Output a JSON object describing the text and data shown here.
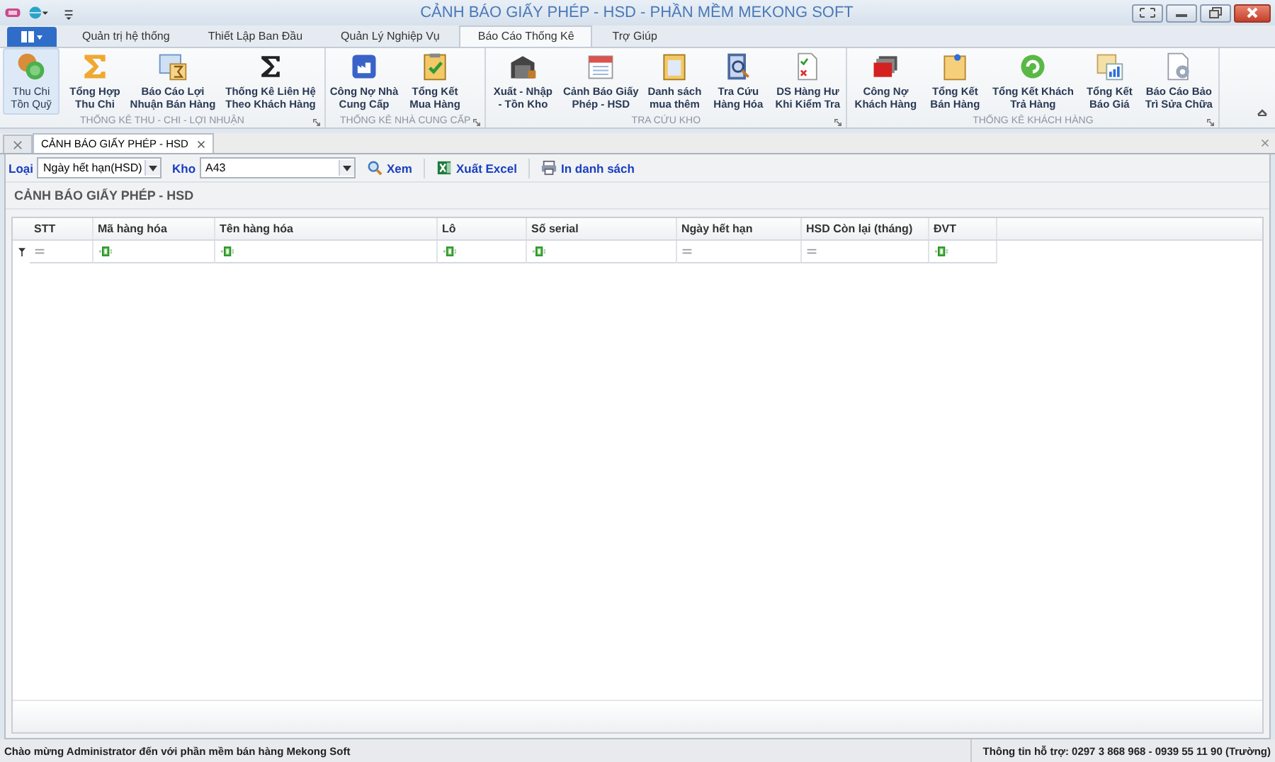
{
  "window": {
    "title": "CẢNH BÁO GIẤY PHÉP - HSD - PHẦN MỀM MEKONG SOFT"
  },
  "ribbon": {
    "tabs": [
      {
        "label": "Quản trị hệ thống",
        "selected": false
      },
      {
        "label": "Thiết Lập Ban Đầu",
        "selected": false
      },
      {
        "label": "Quản Lý Nghiệp Vụ",
        "selected": false
      },
      {
        "label": "Báo Cáo Thống Kê",
        "selected": true
      },
      {
        "label": "Trợ Giúp",
        "selected": false
      }
    ],
    "groups": [
      {
        "label": "THỐNG KÊ THU - CHI - LỢI NHUẬN",
        "buttons": [
          {
            "lines": [
              "Thu Chi",
              "Tồn Quỹ"
            ],
            "selected": true
          },
          {
            "lines": [
              "Tổng Hợp",
              "Thu Chi"
            ],
            "selected": false
          },
          {
            "lines": [
              "Báo Cáo Lợi",
              "Nhuận Bán Hàng"
            ],
            "selected": false
          },
          {
            "lines": [
              "Thống Kê Liên Hệ",
              "Theo Khách Hàng"
            ],
            "selected": false
          }
        ]
      },
      {
        "label": "THỐNG KÊ NHÀ CUNG CẤP",
        "buttons": [
          {
            "lines": [
              "Công Nợ Nhà",
              "Cung Cấp"
            ],
            "selected": false
          },
          {
            "lines": [
              "Tổng Kết",
              "Mua Hàng"
            ],
            "selected": false
          }
        ]
      },
      {
        "label": "TRA CỨU KHO",
        "buttons": [
          {
            "lines": [
              "Xuất - Nhập",
              "- Tồn Kho"
            ],
            "selected": false
          },
          {
            "lines": [
              "Cảnh Báo Giấy",
              "Phép - HSD"
            ],
            "selected": false
          },
          {
            "lines": [
              "Danh sách",
              "mua thêm"
            ],
            "selected": false
          },
          {
            "lines": [
              "Tra Cứu",
              "Hàng Hóa"
            ],
            "selected": false
          },
          {
            "lines": [
              "DS Hàng Hư",
              "Khi Kiểm Tra"
            ],
            "selected": false
          }
        ]
      },
      {
        "label": "THỐNG KÊ KHÁCH HÀNG",
        "buttons": [
          {
            "lines": [
              "Công Nợ",
              "Khách Hàng"
            ],
            "selected": false
          },
          {
            "lines": [
              "Tổng Kết",
              "Bán Hàng"
            ],
            "selected": false
          },
          {
            "lines": [
              "Tổng Kết Khách",
              "Trả Hàng"
            ],
            "selected": false
          },
          {
            "lines": [
              "Tổng Kết",
              "Báo Giá"
            ],
            "selected": false
          },
          {
            "lines": [
              "Báo Cáo Bảo",
              "Trì Sửa Chữa"
            ],
            "selected": false
          }
        ]
      }
    ]
  },
  "document_tabs": [
    {
      "label": "CẢNH BÁO GIẤY PHÉP - HSD",
      "selected": true
    }
  ],
  "toolbar": {
    "type_label": "Loại",
    "type_value": "Ngày hết hạn(HSD)",
    "warehouse_label": "Kho",
    "warehouse_value": "A43",
    "actions": [
      "Xem",
      "Xuất Excel",
      "In danh sách"
    ]
  },
  "report": {
    "title": "CẢNH BÁO GIẤY PHÉP - HSD",
    "columns": [
      {
        "header": "STT",
        "kind": "equals"
      },
      {
        "header": "Mã hàng hóa",
        "kind": "contains"
      },
      {
        "header": "Tên hàng hóa",
        "kind": "contains"
      },
      {
        "header": "Lô",
        "kind": "contains"
      },
      {
        "header": "Số serial",
        "kind": "contains"
      },
      {
        "header": "Ngày hết hạn",
        "kind": "equals"
      },
      {
        "header": "HSD Còn lại (tháng)",
        "kind": "equals"
      },
      {
        "header": "ĐVT",
        "kind": "contains"
      }
    ]
  },
  "status_bar": {
    "message": "Chào mừng Administrator đến với phần mềm bán hàng Mekong Soft",
    "support": "Thông tin hỗ trợ: 0297 3 868 968 - 0939 55 11 90 (Trường)"
  }
}
